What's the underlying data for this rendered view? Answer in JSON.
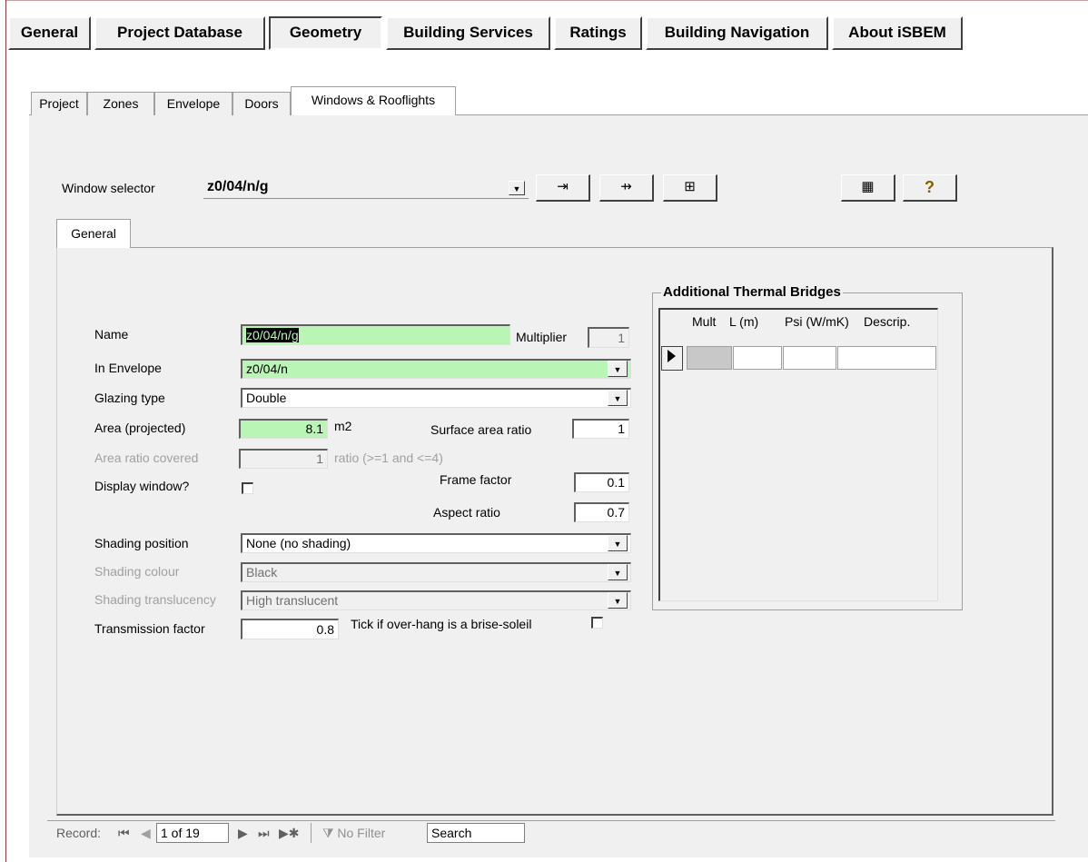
{
  "top_menu": [
    {
      "label": "General"
    },
    {
      "label": "Project Database"
    },
    {
      "label": "Geometry"
    },
    {
      "label": "Building Services"
    },
    {
      "label": "Ratings"
    },
    {
      "label": "Building Navigation"
    },
    {
      "label": "About iSBEM"
    }
  ],
  "tabs": [
    {
      "label": "Project"
    },
    {
      "label": "Zones"
    },
    {
      "label": "Envelope"
    },
    {
      "label": "Doors"
    },
    {
      "label": "Windows & Rooflights"
    }
  ],
  "selector": {
    "label": "Window selector",
    "value": "z0/04/n/g"
  },
  "inner_tab": "General",
  "form": {
    "name_label": "Name",
    "name_value": "z0/04/n/g",
    "multiplier_label": "Multiplier",
    "multiplier_value": "1",
    "envelope_label": "In Envelope",
    "envelope_value": "z0/04/n",
    "glazing_label": "Glazing type",
    "glazing_value": "Double",
    "area_label": "Area (projected)",
    "area_value": "8.1",
    "area_unit": "m2",
    "surface_ratio_label": "Surface area ratio",
    "surface_ratio_value": "1",
    "area_covered_label": "Area ratio covered",
    "area_covered_value": "1",
    "area_covered_hint": "ratio (>=1 and <=4)",
    "display_window_label": "Display window?",
    "frame_factor_label": "Frame factor",
    "frame_factor_value": "0.1",
    "aspect_ratio_label": "Aspect ratio",
    "aspect_ratio_value": "0.7",
    "shading_position_label": "Shading position",
    "shading_position_value": "None (no shading)",
    "shading_colour_label": "Shading colour",
    "shading_colour_value": "Black",
    "shading_translucency_label": "Shading translucency",
    "shading_translucency_value": "High translucent",
    "transmission_label": "Transmission factor",
    "transmission_value": "0.8",
    "brise_soleil_label": "Tick if over-hang is a brise-soleil"
  },
  "thermal_bridges": {
    "title": "Additional Thermal Bridges",
    "columns": [
      "Mult",
      "L (m)",
      "Psi (W/mK)",
      "Descrip."
    ]
  },
  "record_nav": {
    "record_label": "Record:",
    "position": "1 of 19",
    "filter_label": "No Filter",
    "search_label": "Search"
  },
  "colors": {
    "green_field": "#b9f5b5",
    "panel": "#f0f0f0"
  }
}
